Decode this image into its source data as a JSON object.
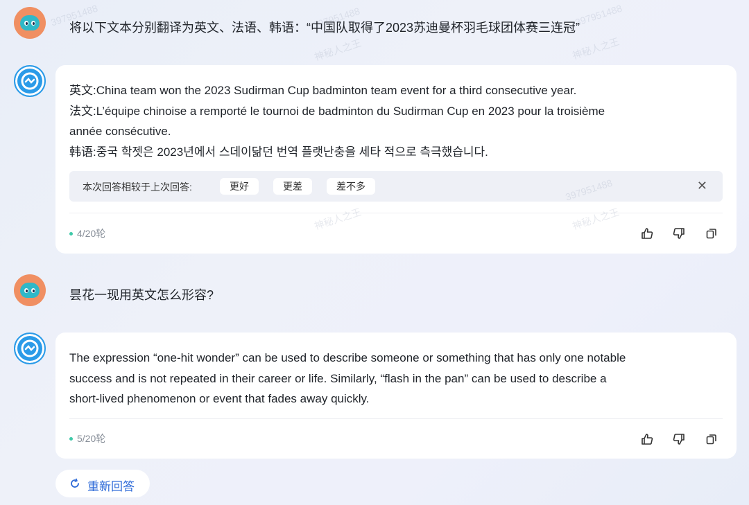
{
  "watermark": {
    "id_text": "397951488",
    "name_text": "神秘人之王"
  },
  "messages": [
    {
      "role": "user",
      "text": "将以下文本分别翻译为英文、法语、韩语：“中国队取得了2023苏迪曼杯羽毛球团体赛三连冠”"
    },
    {
      "role": "assistant",
      "lines": [
        "英文:China team won the 2023 Sudirman Cup badminton team event for a third consecutive year.",
        "法文:L’équipe chinoise a remporté le tournoi de badminton du Sudirman Cup en 2023 pour la troisième",
        "année consécutive.",
        "韩语:중국 학젯은 2023년에서 스데이닮던 번역 플랫난충을 세타 적으로 측극했습니다."
      ],
      "feedback": {
        "label": "本次回答相较于上次回答:",
        "options": [
          "更好",
          "更差",
          "差不多"
        ],
        "close_icon": "close-icon"
      },
      "turn_counter": "4/20轮",
      "actions": [
        "thumbs-up-icon",
        "thumbs-down-icon",
        "copy-icon"
      ]
    },
    {
      "role": "user",
      "text": "昙花一现用英文怎么形容?"
    },
    {
      "role": "assistant",
      "lines": [
        "The expression “one-hit wonder” can be used to describe someone or something that has only one notable",
        "success and is not repeated in their career or life. Similarly, “flash in the pan” can be used to describe a",
        "short-lived phenomenon or event that fades away quickly."
      ],
      "turn_counter": "5/20轮",
      "actions": [
        "thumbs-up-icon",
        "thumbs-down-icon",
        "copy-icon"
      ]
    }
  ],
  "regenerate": {
    "label": "重新回答",
    "icon": "refresh-icon"
  },
  "colors": {
    "accent": "#2f6bd8",
    "turn_dot": "#3fc9a8",
    "card_bg": "#ffffff",
    "feedback_bg": "#eef0f6"
  }
}
